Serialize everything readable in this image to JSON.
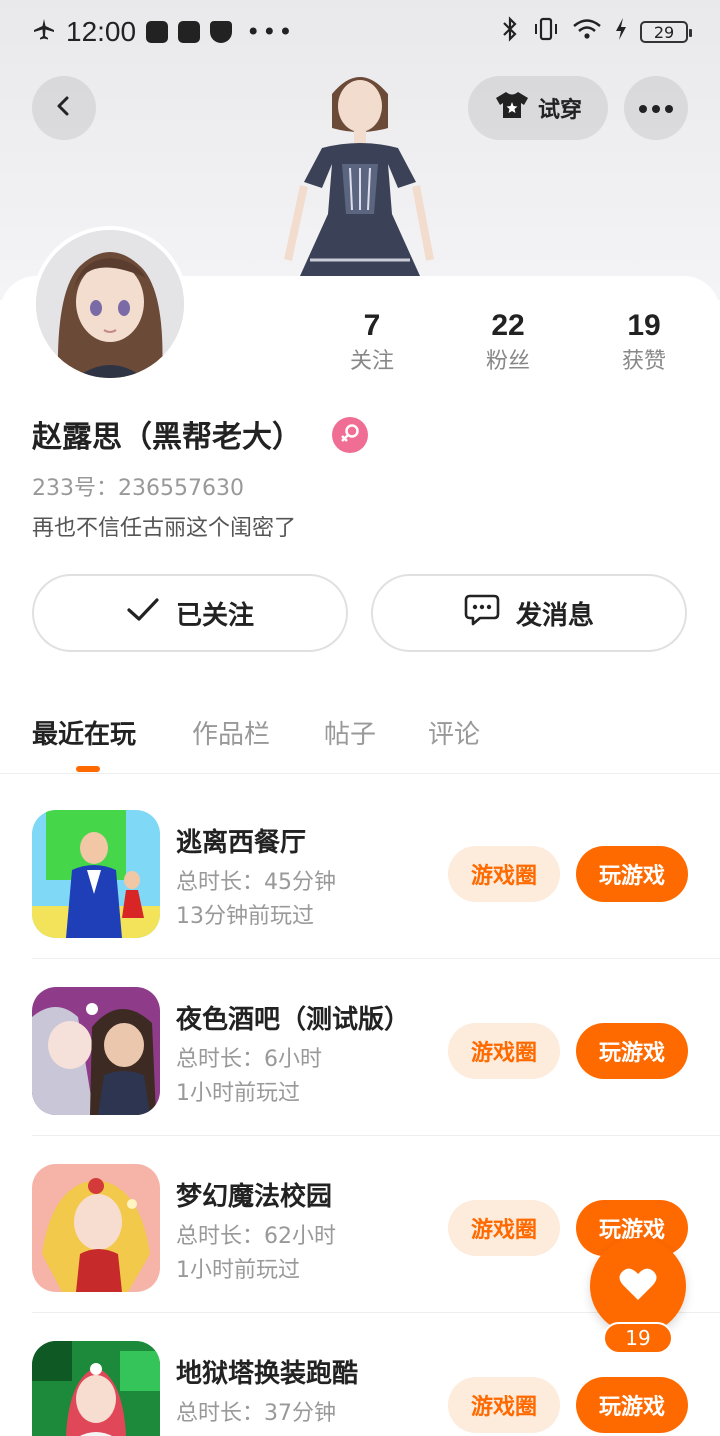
{
  "status_bar": {
    "time": "12:00",
    "battery": "29"
  },
  "header": {
    "try_on_label": "试穿"
  },
  "profile": {
    "name": "赵露思（黑帮老大）",
    "id_text": "233号：236557630",
    "bio": "再也不信任古丽这个闺密了",
    "stats": [
      {
        "num": "7",
        "label": "关注"
      },
      {
        "num": "22",
        "label": "粉丝"
      },
      {
        "num": "19",
        "label": "获赞"
      }
    ],
    "follow_label": "已关注",
    "message_label": "发消息"
  },
  "tabs": [
    "最近在玩",
    "作品栏",
    "帖子",
    "评论"
  ],
  "games": [
    {
      "title": "逃离西餐厅",
      "duration": "总时长：45分钟",
      "last_played": "13分钟前玩过",
      "circle_label": "游戏圈",
      "play_label": "玩游戏"
    },
    {
      "title": "夜色酒吧（测试版）",
      "duration": "总时长：6小时",
      "last_played": "1小时前玩过",
      "circle_label": "游戏圈",
      "play_label": "玩游戏"
    },
    {
      "title": "梦幻魔法校园",
      "duration": "总时长：62小时",
      "last_played": "1小时前玩过",
      "circle_label": "游戏圈",
      "play_label": "玩游戏"
    },
    {
      "title": "地狱塔换装跑酷",
      "duration": "总时长：37分钟",
      "last_played": "",
      "circle_label": "游戏圈",
      "play_label": "玩游戏"
    }
  ],
  "like_count": "19",
  "colors": {
    "accent": "#ff6a00",
    "accent_light": "#fdebdc",
    "female_badge": "#f06e93"
  },
  "icons": [
    "airplane-icon",
    "bluetooth-icon",
    "wifi-icon",
    "back-arrow-icon",
    "shirt-icon",
    "more-icon",
    "female-icon",
    "check-icon",
    "message-icon",
    "heart-icon"
  ]
}
